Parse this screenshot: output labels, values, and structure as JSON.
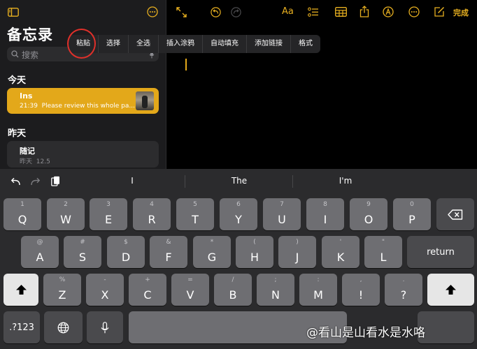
{
  "sidebar": {
    "title": "备忘录",
    "search_placeholder": "搜索",
    "sections": {
      "today": "今天",
      "yesterday": "昨天"
    },
    "notes": [
      {
        "title": "Ins",
        "time": "21:39",
        "preview": "Please review this whole pa..."
      },
      {
        "title": "随记",
        "time": "昨天",
        "preview": "12.5"
      }
    ]
  },
  "toolbar": {
    "font_label": "Aa",
    "done_label": "完成"
  },
  "context_menu": [
    "粘贴",
    "选择",
    "全选",
    "插入涂鸦",
    "自动填充",
    "添加链接",
    "格式"
  ],
  "suggestions": [
    "I",
    "The",
    "I'm"
  ],
  "keyboard": {
    "row1": [
      {
        "main": "Q",
        "sub": "1"
      },
      {
        "main": "W",
        "sub": "2"
      },
      {
        "main": "E",
        "sub": "3"
      },
      {
        "main": "R",
        "sub": "4"
      },
      {
        "main": "T",
        "sub": "5"
      },
      {
        "main": "Y",
        "sub": "6"
      },
      {
        "main": "U",
        "sub": "7"
      },
      {
        "main": "I",
        "sub": "8"
      },
      {
        "main": "O",
        "sub": "9"
      },
      {
        "main": "P",
        "sub": "0"
      }
    ],
    "row2": [
      {
        "main": "A",
        "sub": "@"
      },
      {
        "main": "S",
        "sub": "#"
      },
      {
        "main": "D",
        "sub": "$"
      },
      {
        "main": "F",
        "sub": "&"
      },
      {
        "main": "G",
        "sub": "*"
      },
      {
        "main": "H",
        "sub": "("
      },
      {
        "main": "J",
        "sub": ")"
      },
      {
        "main": "K",
        "sub": "'"
      },
      {
        "main": "L",
        "sub": "\""
      }
    ],
    "row3": [
      {
        "main": "Z",
        "sub": "%"
      },
      {
        "main": "X",
        "sub": "-"
      },
      {
        "main": "C",
        "sub": "+"
      },
      {
        "main": "V",
        "sub": "="
      },
      {
        "main": "B",
        "sub": "/"
      },
      {
        "main": "N",
        "sub": ";"
      },
      {
        "main": "M",
        "sub": ":"
      },
      {
        "main": "!",
        "sub": ","
      },
      {
        "main": "?",
        "sub": "."
      }
    ],
    "return_label": "return",
    "numbers_label": ".?123"
  },
  "watermark": "@看山是山看水是水咯"
}
